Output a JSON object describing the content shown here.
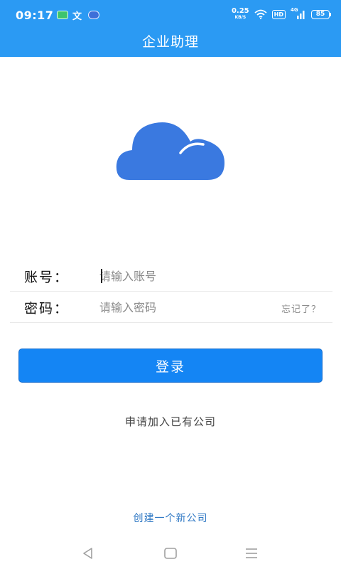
{
  "status_bar": {
    "time": "09:17",
    "network_speed": "0.25",
    "speed_unit": "KB/S",
    "hd_badge": "HD",
    "signal_label": "4G",
    "battery": "85",
    "icons": [
      "message-app-icon",
      "translate-icon",
      "chat-bubble-icon",
      "wifi-icon",
      "signal-icon",
      "battery-icon"
    ]
  },
  "header": {
    "title": "企业助理"
  },
  "logo": {
    "icon": "cloud-logo-icon",
    "color": "#3a79e0"
  },
  "form": {
    "account_label": "账号：",
    "account_placeholder": "请输入账号",
    "password_label": "密码：",
    "password_placeholder": "请输入密码",
    "forgot_label": "忘记了？"
  },
  "login_button": {
    "label": "登录"
  },
  "links": {
    "join": "申请加入已有公司",
    "create": "创建一个新公司"
  },
  "nav_bar": {
    "icons": [
      "back-icon",
      "home-icon",
      "menu-icon"
    ]
  },
  "colors": {
    "header_bg": "#2b9af3",
    "button_bg": "#1485f4",
    "link": "#2f78c4"
  }
}
